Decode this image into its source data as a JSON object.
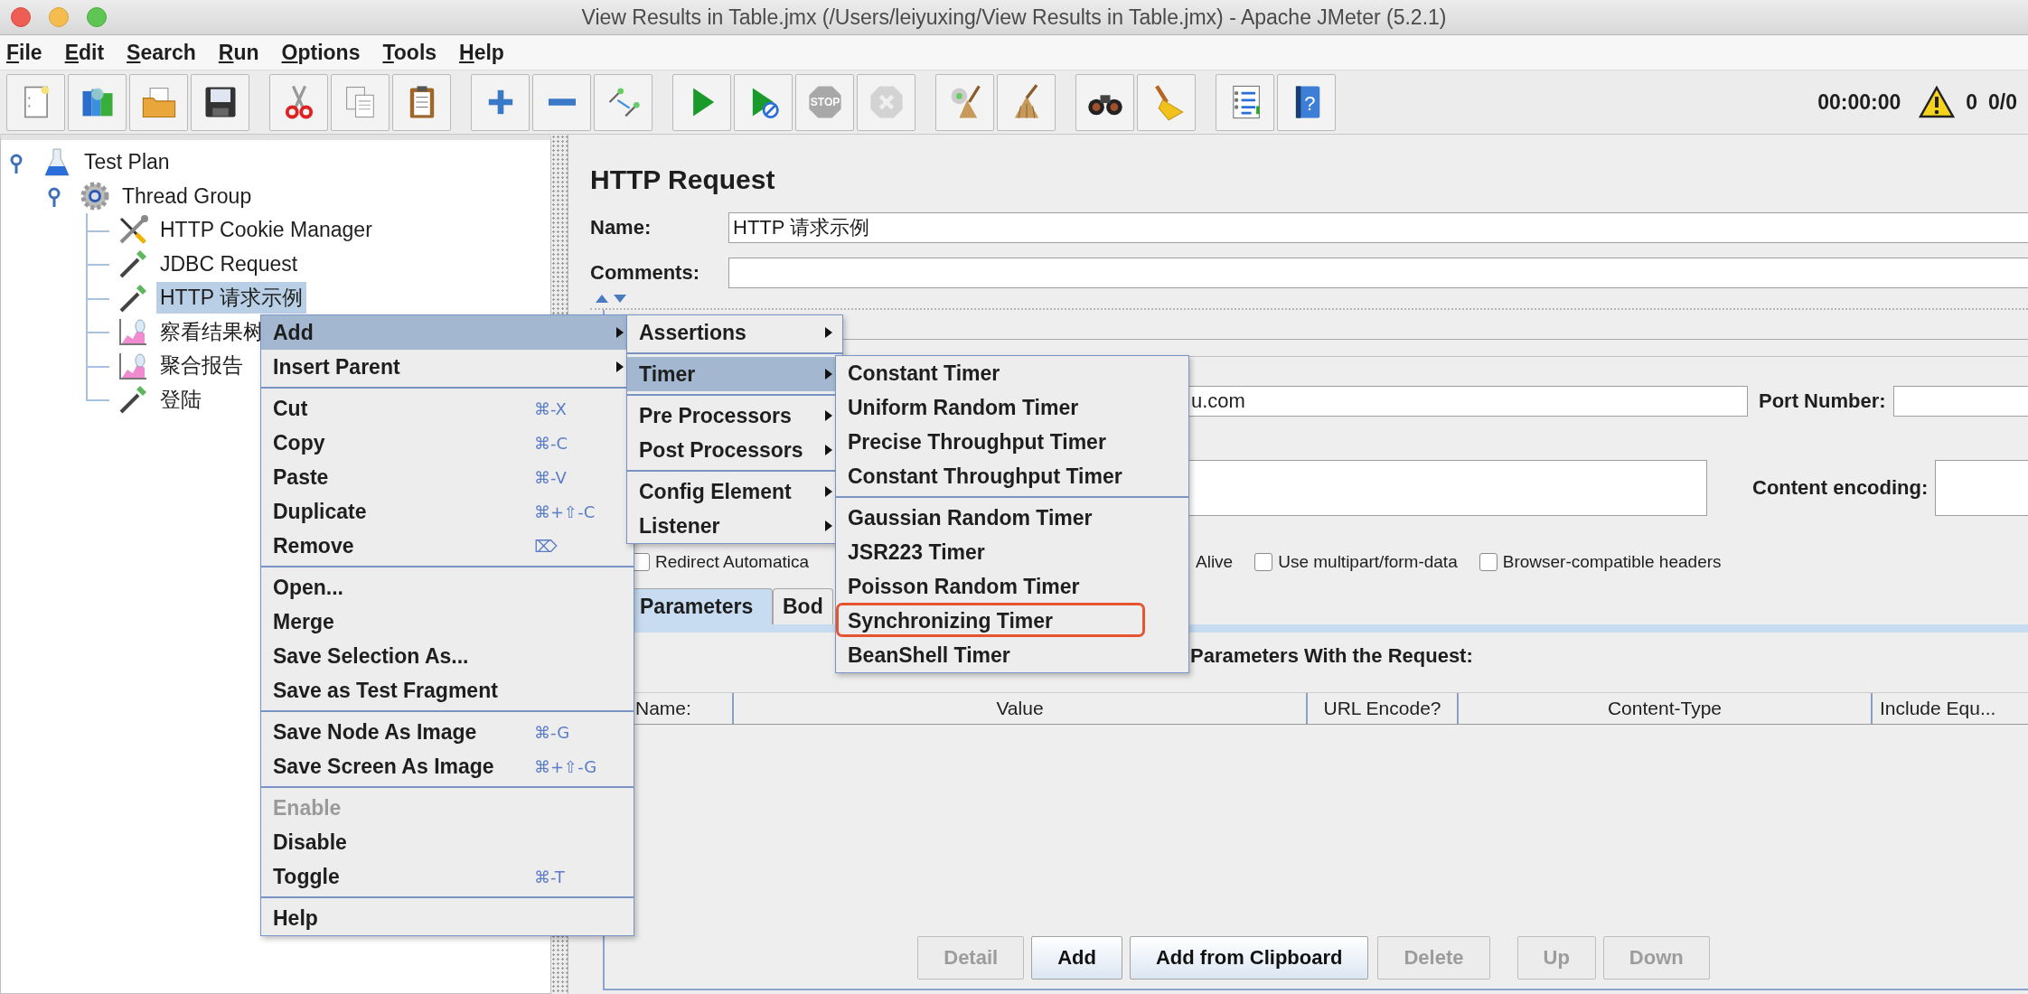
{
  "window": {
    "title": "View Results in Table.jmx (/Users/leiyuxing/View Results in Table.jmx) - Apache JMeter (5.2.1)"
  },
  "menu_bar": [
    {
      "mnemonic": "F",
      "rest": "ile"
    },
    {
      "mnemonic": "E",
      "rest": "dit"
    },
    {
      "mnemonic": "S",
      "rest": "earch"
    },
    {
      "mnemonic": "R",
      "rest": "un"
    },
    {
      "mnemonic": "O",
      "rest": "ptions"
    },
    {
      "mnemonic": "T",
      "rest": "ools"
    },
    {
      "mnemonic": "H",
      "rest": "elp"
    }
  ],
  "toolbar_groups": [
    {
      "buttons": [
        {
          "kind": "new",
          "disabled": false
        },
        {
          "kind": "templates",
          "disabled": false
        },
        {
          "kind": "open",
          "disabled": false
        },
        {
          "kind": "save",
          "disabled": false
        }
      ]
    },
    {
      "buttons": [
        {
          "kind": "cut",
          "disabled": false
        },
        {
          "kind": "copy",
          "disabled": false
        },
        {
          "kind": "paste",
          "disabled": false
        }
      ]
    },
    {
      "buttons": [
        {
          "kind": "expand",
          "disabled": false
        },
        {
          "kind": "collapse",
          "disabled": false
        },
        {
          "kind": "toggle",
          "disabled": false
        }
      ]
    },
    {
      "buttons": [
        {
          "kind": "start",
          "disabled": false
        },
        {
          "kind": "start_no_pause",
          "disabled": false
        },
        {
          "kind": "stop",
          "disabled": true,
          "text": "STOP"
        },
        {
          "kind": "shutdown",
          "disabled": true
        }
      ]
    },
    {
      "buttons": [
        {
          "kind": "clear",
          "disabled": false
        },
        {
          "kind": "clear_all",
          "disabled": false
        }
      ]
    },
    {
      "buttons": [
        {
          "kind": "search",
          "disabled": false
        },
        {
          "kind": "reset_search",
          "disabled": false
        }
      ]
    },
    {
      "buttons": [
        {
          "kind": "function_helper",
          "disabled": false
        },
        {
          "kind": "help",
          "disabled": false,
          "text": "?"
        }
      ]
    }
  ],
  "status": {
    "elapsed": "00:00:00",
    "warnings": "0",
    "threads": "0/0"
  },
  "tree": [
    {
      "label": "Test Plan",
      "kind": "plan",
      "selected": false,
      "expanded": true,
      "children": [
        {
          "label": "Thread Group",
          "kind": "thread-group",
          "selected": false,
          "expanded": true,
          "children": [
            {
              "label": "HTTP Cookie Manager",
              "kind": "config",
              "selected": false
            },
            {
              "label": "JDBC Request",
              "kind": "sampler",
              "selected": false
            },
            {
              "label": "HTTP 请求示例",
              "kind": "sampler",
              "selected": true
            },
            {
              "label": "察看结果树",
              "kind": "listener",
              "selected": false
            },
            {
              "label": "聚合报告",
              "kind": "listener",
              "selected": false
            },
            {
              "label": "登陆",
              "kind": "sampler",
              "selected": false
            }
          ]
        }
      ]
    }
  ],
  "panel": {
    "title": "HTTP Request",
    "name_label": "Name:",
    "name_value": "HTTP 请求示例",
    "comments_label": "Comments:"
  },
  "server_row": {
    "server_value": "u.com",
    "port_label": "Port Number:"
  },
  "path_row": {
    "encoding_label": "Content encoding:"
  },
  "options": [
    {
      "kind": "checkbox",
      "label": "Redirect Automatica",
      "checked": false
    },
    {
      "kind": "text",
      "label": "Alive"
    },
    {
      "kind": "checkbox",
      "label": "Use multipart/form-data",
      "checked": false
    },
    {
      "kind": "checkbox",
      "label": "Browser-compatible headers",
      "checked": false
    }
  ],
  "tabs": [
    {
      "label": "Parameters",
      "selected": true
    },
    {
      "label": "Bod",
      "selected": false
    }
  ],
  "parameters_caption": "Parameters With the Request:",
  "table": {
    "columns": [
      "Name:",
      "Value",
      "URL Encode?",
      "Content-Type",
      "Include Equ..."
    ]
  },
  "buttons": [
    {
      "label": "Detail",
      "disabled": true
    },
    {
      "label": "Add",
      "disabled": false
    },
    {
      "label": "Add from Clipboard",
      "disabled": false
    },
    {
      "label": "Delete",
      "disabled": true
    },
    {
      "label": "Up",
      "disabled": true
    },
    {
      "label": "Down",
      "disabled": true
    }
  ],
  "context_menu": {
    "items": [
      {
        "kind": "item",
        "label": "Add",
        "has_submenu": true,
        "selected": true,
        "disabled": false
      },
      {
        "kind": "item",
        "label": "Insert Parent",
        "has_submenu": true,
        "selected": false,
        "disabled": false
      },
      {
        "kind": "separator"
      },
      {
        "kind": "item",
        "label": "Cut",
        "shortcut": "⌘-X",
        "has_submenu": false,
        "selected": false,
        "disabled": false
      },
      {
        "kind": "item",
        "label": "Copy",
        "shortcut": "⌘-C",
        "has_submenu": false,
        "selected": false,
        "disabled": false
      },
      {
        "kind": "item",
        "label": "Paste",
        "shortcut": "⌘-V",
        "has_submenu": false,
        "selected": false,
        "disabled": false
      },
      {
        "kind": "item",
        "label": "Duplicate",
        "shortcut": "⌘+⇧-C",
        "has_submenu": false,
        "selected": false,
        "disabled": false
      },
      {
        "kind": "item",
        "label": "Remove",
        "shortcut": "⌦",
        "has_submenu": false,
        "selected": false,
        "disabled": false
      },
      {
        "kind": "separator"
      },
      {
        "kind": "item",
        "label": "Open...",
        "has_submenu": false,
        "selected": false,
        "disabled": false
      },
      {
        "kind": "item",
        "label": "Merge",
        "has_submenu": false,
        "selected": false,
        "disabled": false
      },
      {
        "kind": "item",
        "label": "Save Selection As...",
        "has_submenu": false,
        "selected": false,
        "disabled": false
      },
      {
        "kind": "item",
        "label": "Save as Test Fragment",
        "has_submenu": false,
        "selected": false,
        "disabled": false
      },
      {
        "kind": "separator"
      },
      {
        "kind": "item",
        "label": "Save Node As Image",
        "shortcut": "⌘-G",
        "has_submenu": false,
        "selected": false,
        "disabled": false
      },
      {
        "kind": "item",
        "label": "Save Screen As Image",
        "shortcut": "⌘+⇧-G",
        "has_submenu": false,
        "selected": false,
        "disabled": false
      },
      {
        "kind": "separator"
      },
      {
        "kind": "item",
        "label": "Enable",
        "has_submenu": false,
        "selected": false,
        "disabled": true
      },
      {
        "kind": "item",
        "label": "Disable",
        "has_submenu": false,
        "selected": false,
        "disabled": false
      },
      {
        "kind": "item",
        "label": "Toggle",
        "shortcut": "⌘-T",
        "has_submenu": false,
        "selected": false,
        "disabled": false
      },
      {
        "kind": "separator"
      },
      {
        "kind": "item",
        "label": "Help",
        "has_submenu": false,
        "selected": false,
        "disabled": false
      }
    ]
  },
  "add_submenu": {
    "items": [
      {
        "kind": "item",
        "label": "Assertions",
        "has_submenu": true,
        "selected": false,
        "disabled": false
      },
      {
        "kind": "separator"
      },
      {
        "kind": "item",
        "label": "Timer",
        "has_submenu": true,
        "selected": true,
        "disabled": false
      },
      {
        "kind": "separator"
      },
      {
        "kind": "item",
        "label": "Pre Processors",
        "has_submenu": true,
        "selected": false,
        "disabled": false
      },
      {
        "kind": "item",
        "label": "Post Processors",
        "has_submenu": true,
        "selected": false,
        "disabled": false
      },
      {
        "kind": "separator"
      },
      {
        "kind": "item",
        "label": "Config Element",
        "has_submenu": true,
        "selected": false,
        "disabled": false
      },
      {
        "kind": "item",
        "label": "Listener",
        "has_submenu": true,
        "selected": false,
        "disabled": false
      }
    ]
  },
  "timer_submenu": {
    "items": [
      {
        "kind": "item",
        "label": "Constant Timer",
        "has_submenu": false,
        "selected": false,
        "disabled": false
      },
      {
        "kind": "item",
        "label": "Uniform Random Timer",
        "has_submenu": false,
        "selected": false,
        "disabled": false
      },
      {
        "kind": "item",
        "label": "Precise Throughput Timer",
        "has_submenu": false,
        "selected": false,
        "disabled": false
      },
      {
        "kind": "item",
        "label": "Constant Throughput Timer",
        "has_submenu": false,
        "selected": false,
        "disabled": false
      },
      {
        "kind": "separator"
      },
      {
        "kind": "item",
        "label": "Gaussian Random Timer",
        "has_submenu": false,
        "selected": false,
        "disabled": false
      },
      {
        "kind": "item",
        "label": "JSR223 Timer",
        "has_submenu": false,
        "selected": false,
        "disabled": false
      },
      {
        "kind": "item",
        "label": "Poisson Random Timer",
        "has_submenu": false,
        "selected": false,
        "disabled": false
      },
      {
        "kind": "item",
        "label": "Synchronizing Timer",
        "has_submenu": false,
        "selected": false,
        "disabled": false,
        "outlined": true
      },
      {
        "kind": "item",
        "label": "BeanShell Timer",
        "has_submenu": false,
        "selected": false,
        "disabled": false
      }
    ]
  }
}
